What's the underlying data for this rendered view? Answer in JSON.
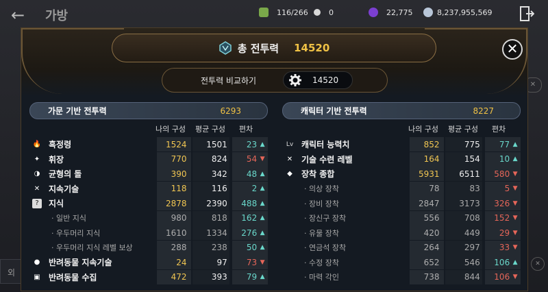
{
  "topbar": {
    "back_icon": "back-arrow-icon",
    "title": "가방",
    "currencies": [
      {
        "icon": "green-gem-icon",
        "color": "#7aa84a",
        "value": "116/266"
      },
      {
        "icon": "white-pearl-icon",
        "color": "#d8d8d8",
        "value": "0"
      },
      {
        "icon": "purple-orb-icon",
        "color": "#7b3fd0",
        "value": "22,775"
      },
      {
        "icon": "silver-coin-icon",
        "color": "#b8c6d8",
        "value": "8,237,955,569"
      }
    ],
    "exit_icon": "exit-door-icon"
  },
  "modal": {
    "title": "총 전투력",
    "title_value": "14520",
    "compare_label": "전투력 비교하기",
    "compare_value": "14520",
    "close_icon": "close-icon"
  },
  "columns": {
    "my": "나의 구성",
    "avg": "평균 구성",
    "diff": "편차"
  },
  "left_panel": {
    "title": "가문 기반 전투력",
    "value": "6293",
    "rows": [
      {
        "icon": "abyss-flame-icon",
        "label": "흑정령",
        "my": "1524",
        "avg": "1501",
        "diff": "23",
        "dir": "up",
        "sub": false
      },
      {
        "icon": "emblem-icon",
        "label": "휘장",
        "my": "770",
        "avg": "824",
        "diff": "54",
        "dir": "down",
        "sub": false
      },
      {
        "icon": "balance-stone-icon",
        "label": "균형의 돌",
        "my": "390",
        "avg": "342",
        "diff": "48",
        "dir": "up",
        "sub": false
      },
      {
        "icon": "crossed-tools-icon",
        "label": "지속기술",
        "my": "118",
        "avg": "116",
        "diff": "2",
        "dir": "up",
        "sub": false
      },
      {
        "icon": "question-icon",
        "label": "지식",
        "my": "2878",
        "avg": "2390",
        "diff": "488",
        "dir": "up",
        "sub": false
      },
      {
        "icon": "",
        "label": "· 일반 지식",
        "my": "980",
        "avg": "818",
        "diff": "162",
        "dir": "up",
        "sub": true
      },
      {
        "icon": "",
        "label": "· 우두머리 지식",
        "my": "1610",
        "avg": "1334",
        "diff": "276",
        "dir": "up",
        "sub": true
      },
      {
        "icon": "",
        "label": "· 우두머리 지식 레벨 보상",
        "my": "288",
        "avg": "238",
        "diff": "50",
        "dir": "up",
        "sub": true
      },
      {
        "icon": "paw-icon",
        "label": "반려동물 지속기술",
        "my": "24",
        "avg": "97",
        "diff": "73",
        "dir": "down",
        "sub": false
      },
      {
        "icon": "collection-icon",
        "label": "반려동물 수집",
        "my": "472",
        "avg": "393",
        "diff": "79",
        "dir": "up",
        "sub": false
      }
    ]
  },
  "right_panel": {
    "title": "캐릭터 기반 전투력",
    "value": "8227",
    "rows": [
      {
        "icon": "level-icon",
        "label": "캐릭터 능력치",
        "my": "852",
        "avg": "775",
        "diff": "77",
        "dir": "up",
        "sub": false
      },
      {
        "icon": "crossed-swords-icon",
        "label": "기술 수련 레벨",
        "my": "164",
        "avg": "154",
        "diff": "10",
        "dir": "up",
        "sub": false
      },
      {
        "icon": "shield-icon",
        "label": "장착 종합",
        "my": "5931",
        "avg": "6511",
        "diff": "580",
        "dir": "down",
        "sub": false
      },
      {
        "icon": "",
        "label": "· 의상 장착",
        "my": "78",
        "avg": "83",
        "diff": "5",
        "dir": "down",
        "sub": true
      },
      {
        "icon": "",
        "label": "· 장비 장착",
        "my": "2847",
        "avg": "3173",
        "diff": "326",
        "dir": "down",
        "sub": true
      },
      {
        "icon": "",
        "label": "· 장신구 장착",
        "my": "556",
        "avg": "708",
        "diff": "152",
        "dir": "down",
        "sub": true
      },
      {
        "icon": "",
        "label": "· 유물 장착",
        "my": "420",
        "avg": "449",
        "diff": "29",
        "dir": "down",
        "sub": true
      },
      {
        "icon": "",
        "label": "· 연금석 장착",
        "my": "264",
        "avg": "297",
        "diff": "33",
        "dir": "down",
        "sub": true
      },
      {
        "icon": "",
        "label": "· 수정 장착",
        "my": "652",
        "avg": "546",
        "diff": "106",
        "dir": "up",
        "sub": true
      },
      {
        "icon": "",
        "label": "· 마력 각인",
        "my": "738",
        "avg": "844",
        "diff": "106",
        "dir": "down",
        "sub": true
      }
    ]
  },
  "colors": {
    "gold": "#f0c245",
    "up": "#5fd6c8",
    "down": "#e55b4d"
  }
}
